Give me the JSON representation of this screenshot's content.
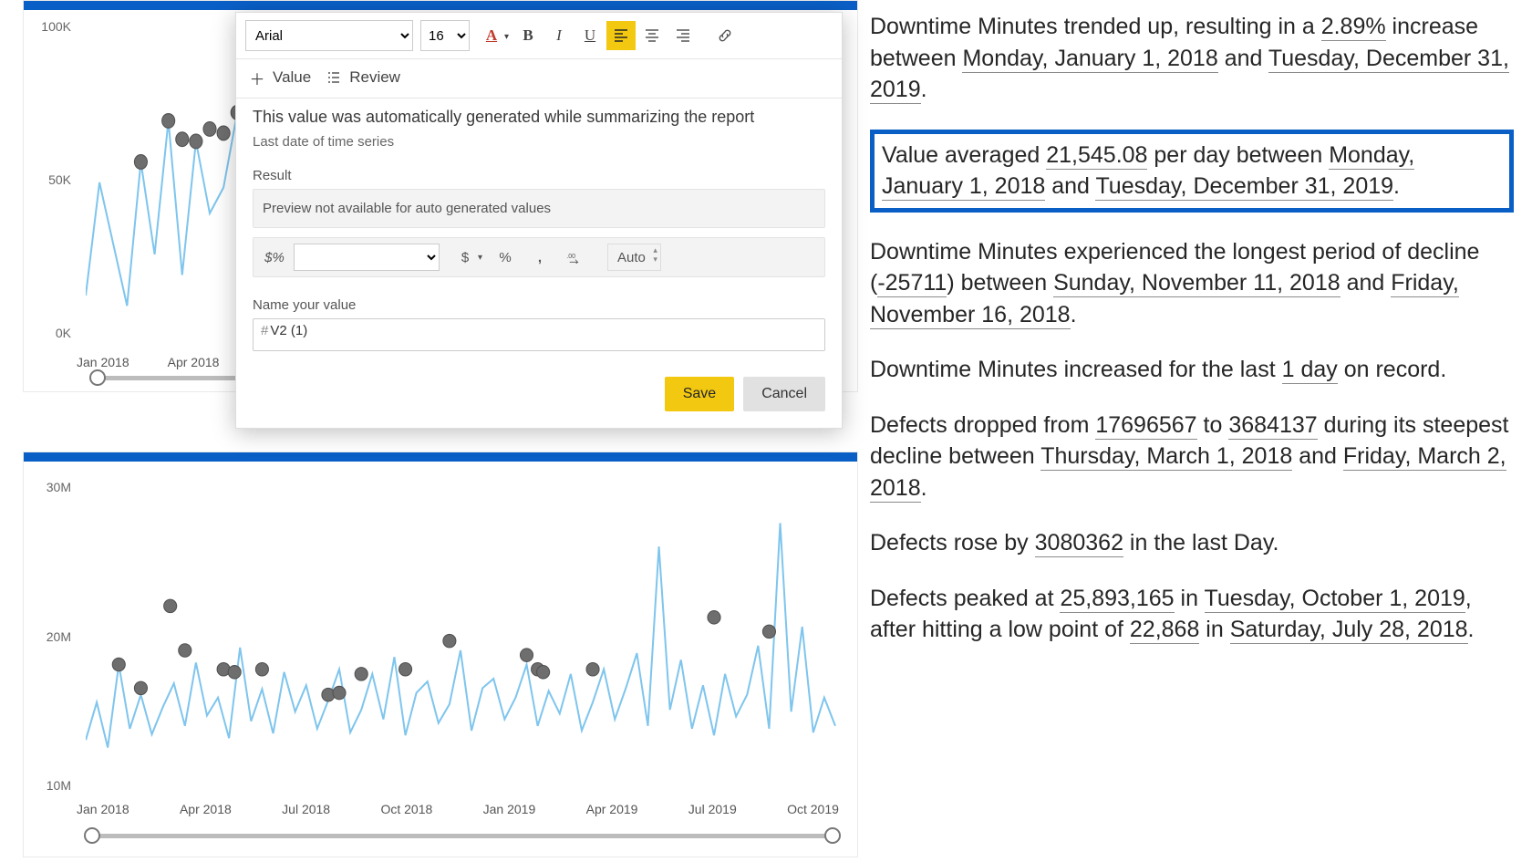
{
  "toolbar": {
    "font": "Arial",
    "size": "16",
    "value_tab": "Value",
    "review_tab": "Review"
  },
  "popup": {
    "description": "This value was automatically generated while summarizing the report",
    "sublabel": "Last date of time series",
    "result_label": "Result",
    "result_preview": "Preview not available for auto generated values",
    "format_symbol": "$%",
    "currency_btn": "$",
    "percent_btn": "%",
    "comma_btn": ",",
    "decimal_btn": ".00",
    "auto_label": "Auto",
    "name_label": "Name your value",
    "name_prefix": "#",
    "name_value": "V2 (1)",
    "save": "Save",
    "cancel": "Cancel"
  },
  "chart_data": [
    {
      "type": "line",
      "title": "Downtime Minutes",
      "ylabel": "",
      "y_ticks": [
        "100K",
        "50K",
        "0K"
      ],
      "x_ticks": [
        "Jan 2018",
        "Apr 2018"
      ],
      "ylim": [
        0,
        100000
      ],
      "x_range": [
        "2018-01",
        "2018-07"
      ],
      "series": [
        {
          "name": "Downtime Minutes",
          "sample_values": [
            12000,
            48000,
            24000,
            8000,
            55000,
            22000,
            68000,
            18000,
            61000,
            35000,
            46000,
            71000,
            19000,
            58000,
            27000,
            64000,
            23000,
            70000,
            30000,
            42000,
            68000,
            52000,
            15000,
            60000,
            25000,
            45000
          ]
        }
      ],
      "anomalies_y": [
        48000,
        64000,
        55000,
        58000,
        61000,
        46000,
        71000,
        52000,
        68000,
        60000
      ]
    },
    {
      "type": "line",
      "title": "Defects",
      "y_ticks": [
        "30M",
        "20M",
        "10M"
      ],
      "x_ticks": [
        "Jan 2018",
        "Apr 2018",
        "Jul 2018",
        "Oct 2018",
        "Jan 2019",
        "Apr 2019",
        "Jul 2019",
        "Oct 2019"
      ],
      "ylim": [
        0,
        30000000
      ],
      "x_range": [
        "2018-01",
        "2019-12"
      ],
      "series": [
        {
          "name": "Defects",
          "sample_values": [
            4000000,
            7000000,
            3500000,
            11500000,
            5000000,
            8200000,
            4500000,
            6800000,
            9000000,
            5200000,
            11800000,
            6000000,
            7800000,
            4300000,
            13200000,
            5500000,
            8800000,
            4700000,
            10500000,
            6300000,
            9200000,
            5000000,
            7500000,
            11000000,
            4800000,
            6500000,
            10800000,
            5900000,
            12200000,
            4600000,
            8300000,
            9800000,
            5400000,
            7100000,
            25900000,
            6800000,
            12500000,
            5200000,
            9600000,
            4900000,
            11300000,
            6100000,
            7800000,
            10200000,
            5600000,
            13800000,
            4400000,
            8900000
          ]
        }
      ],
      "anomalies_y": [
        11500000,
        11800000,
        9000000,
        13200000,
        10500000,
        11000000,
        10800000,
        12200000,
        9800000,
        14800000,
        12500000,
        11300000,
        13800000,
        10200000,
        9600000,
        8800000,
        9200000,
        11200000,
        12100000,
        13500000
      ]
    }
  ],
  "narrative": {
    "p1_a": "Downtime Minutes trended up, resulting in a ",
    "p1_v1": "2.89%",
    "p1_b": " increase between ",
    "p1_v2": "Monday, January 1, 2018",
    "p1_c": " and ",
    "p1_v3": "Tuesday, December 31, 2019",
    "p1_d": ".",
    "p2_a": "Value averaged ",
    "p2_v1": "21,545.08",
    "p2_b": " per day between ",
    "p2_v2": "Monday, January 1, 2018",
    "p2_c": " and ",
    "p2_v3": "Tuesday, December 31, 2019",
    "p2_d": ".",
    "p3_a": "Downtime Minutes experienced the longest period of decline (",
    "p3_v1": "-25711",
    "p3_b": ") between ",
    "p3_v2": "Sunday, November 11, 2018",
    "p3_c": " and ",
    "p3_v3": "Friday, November 16, 2018",
    "p3_d": ".",
    "p4_a": "Downtime Minutes increased for the last ",
    "p4_v1": "1 day",
    "p4_b": " on record.",
    "p5_a": "Defects dropped from ",
    "p5_v1": "17696567",
    "p5_b": " to ",
    "p5_v2": "3684137",
    "p5_c": " during its steepest decline between ",
    "p5_v3": "Thursday, March 1, 2018",
    "p5_d": " and ",
    "p5_v4": "Friday, March 2, 2018",
    "p5_e": ".",
    "p6_a": "Defects rose by ",
    "p6_v1": "3080362",
    "p6_b": " in the last Day.",
    "p7_a": "Defects peaked at ",
    "p7_v1": "25,893,165",
    "p7_b": " in ",
    "p7_v2": "Tuesday, October 1, 2019",
    "p7_c": ", after hitting a low point of ",
    "p7_v3": "22,868",
    "p7_d": " in ",
    "p7_v4": "Saturday, July 28, 2018",
    "p7_e": "."
  }
}
